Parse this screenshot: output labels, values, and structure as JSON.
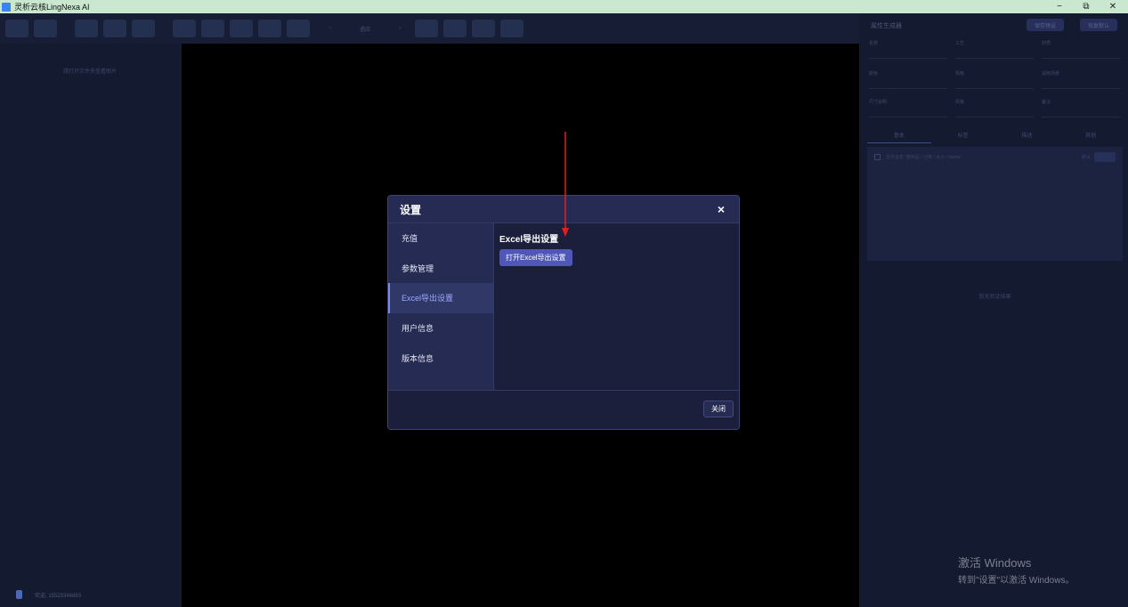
{
  "window": {
    "title": "灵析云核LingNexa AI",
    "controls": {
      "minimize": "−",
      "restore": "⧉",
      "close": "✕"
    }
  },
  "toolbar": {
    "zoom_text": "适应"
  },
  "left_panel": {
    "hint": "請打开文件夹查看图片",
    "footer_user": "欢迎, 15523346883"
  },
  "right_panel": {
    "title": "属性生成器",
    "button_1": "保存预设",
    "button_2": "恢复默认",
    "fields": [
      "名称",
      "工艺",
      "材质",
      "颜色",
      "规格",
      "适用场景",
      "尺寸说明",
      "风格",
      "备注"
    ],
    "tabs": [
      "基本",
      "标签",
      "描述",
      "其他"
    ],
    "list_row": "显示信息: 按商品 / 分类 / 大小 / Name",
    "list_tag": "默认",
    "empty_hint": "暂无验证结果"
  },
  "dialog": {
    "title": "设置",
    "close_icon": "×",
    "nav": [
      {
        "label": "充值"
      },
      {
        "label": "参数管理"
      },
      {
        "label": "Excel导出设置"
      },
      {
        "label": "用户信息"
      },
      {
        "label": "版本信息"
      }
    ],
    "active_index": 2,
    "content": {
      "section_title": "Excel导出设置",
      "open_button": "打开Excel导出设置"
    },
    "footer": {
      "close_button": "关闭"
    }
  },
  "annotation": {
    "arrow_color": "#e02020"
  },
  "watermark": {
    "title": "激活 Windows",
    "subtitle": "转到\"设置\"以激活 Windows。"
  },
  "colors": {
    "accent": "#4f58b8",
    "active_nav_text": "#9ea8ff",
    "dialog_bg": "#1c2040"
  }
}
